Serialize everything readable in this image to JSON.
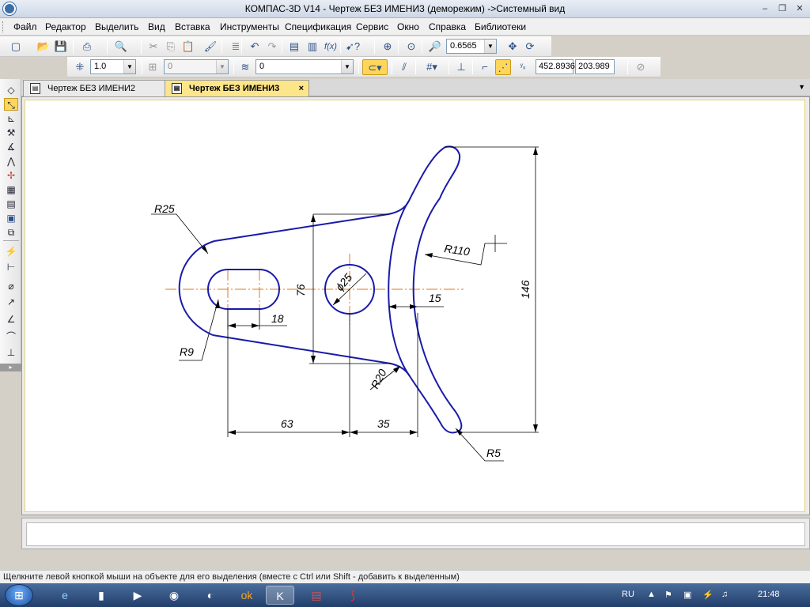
{
  "window": {
    "title": "КОМПАС-3D V14 - Чертеж БЕЗ ИМЕНИ3 (деморежим) ->Системный вид",
    "minimize_glyph": "–",
    "restore_glyph": "❐",
    "close_glyph": "✕"
  },
  "menu": {
    "items": [
      "Файл",
      "Редактор",
      "Выделить",
      "Вид",
      "Вставка",
      "Инструменты",
      "Спецификация",
      "Сервис",
      "Окно",
      "Справка",
      "Библиотеки"
    ]
  },
  "toolbar_standard": {
    "zoom_value": "0.6565"
  },
  "toolbar_current_state": {
    "step_value": "1.0",
    "layer_value": "0",
    "style_value": "0",
    "cursor_x": "452.8936",
    "cursor_y": "203.989"
  },
  "tabs": [
    {
      "label": "Чертеж БЕЗ ИМЕНИ2",
      "active": false
    },
    {
      "label": "Чертеж БЕЗ ИМЕНИ3",
      "active": true
    }
  ],
  "tab_close_glyph": "×",
  "drawing": {
    "dimensions": {
      "r25": "R25",
      "r9": "R9",
      "w18": "18",
      "h76": "76",
      "d25": "ϕ25",
      "r110": "R110",
      "w15": "15",
      "h146": "146",
      "r20": "R20",
      "w63": "63",
      "w35": "35",
      "r5": "R5"
    },
    "colors": {
      "contour": "#1a1aaa",
      "dim_line": "#000000",
      "axis": "#e07b1a"
    }
  },
  "status": {
    "hint": "Щелкните левой кнопкой мыши на объекте для его выделения (вместе с Ctrl или Shift - добавить к выделенным)"
  },
  "taskbar": {
    "lang": "RU",
    "time": "21:48"
  }
}
